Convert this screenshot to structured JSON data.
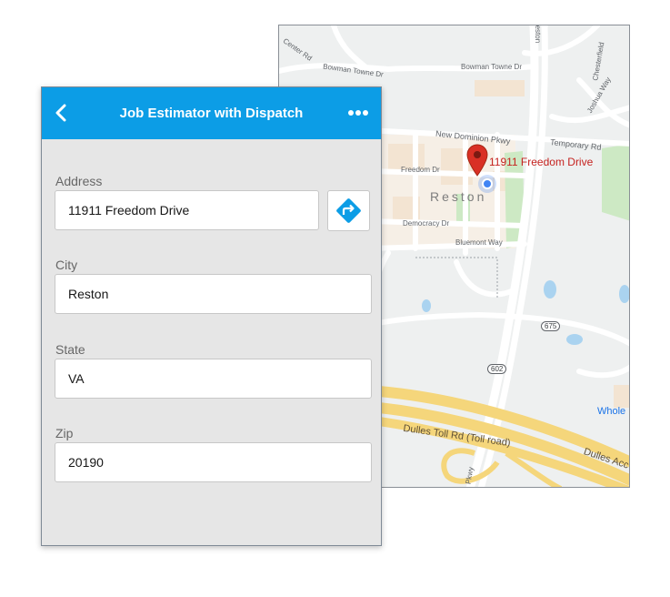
{
  "app": {
    "title": "Job Estimator with Dispatch",
    "back_icon": "chevron-left-icon",
    "more_icon": "more-horizontal-icon",
    "header_color": "#0c9de6"
  },
  "form": {
    "address": {
      "label": "Address",
      "value": "11911 Freedom Drive"
    },
    "directions_icon": "directions-icon",
    "city": {
      "label": "City",
      "value": "Reston"
    },
    "state": {
      "label": "State",
      "value": "VA"
    },
    "zip": {
      "label": "Zip",
      "value": "20190"
    }
  },
  "map": {
    "pin_label": "11911 Freedom Drive",
    "city_label": "Reston",
    "roads": {
      "bowman_towne_dr_1": "Bowman Towne Dr",
      "bowman_towne_dr_2": "Bowman Towne Dr",
      "new_dominion_pkwy": "New Dominion Pkwy",
      "temporary_rd": "Temporary Rd",
      "freedom_dr": "Freedom Dr",
      "democracy_dr": "Democracy Dr",
      "bluemont_way": "Bluemont Way",
      "dulles_toll_rd": "Dulles Toll Rd (Toll road)",
      "dulles_access": "Dulles Acc",
      "reston_pkwy_top": "Reston",
      "reston_pkwy_bottom": "Pkwy",
      "chesterfield": "Chesterfield",
      "joshua": "Joshua Way",
      "center_rd": "Center Rd",
      "whole": "Whole",
      "route_675": "675",
      "route_602": "602"
    },
    "pin_color": "#d93025"
  }
}
